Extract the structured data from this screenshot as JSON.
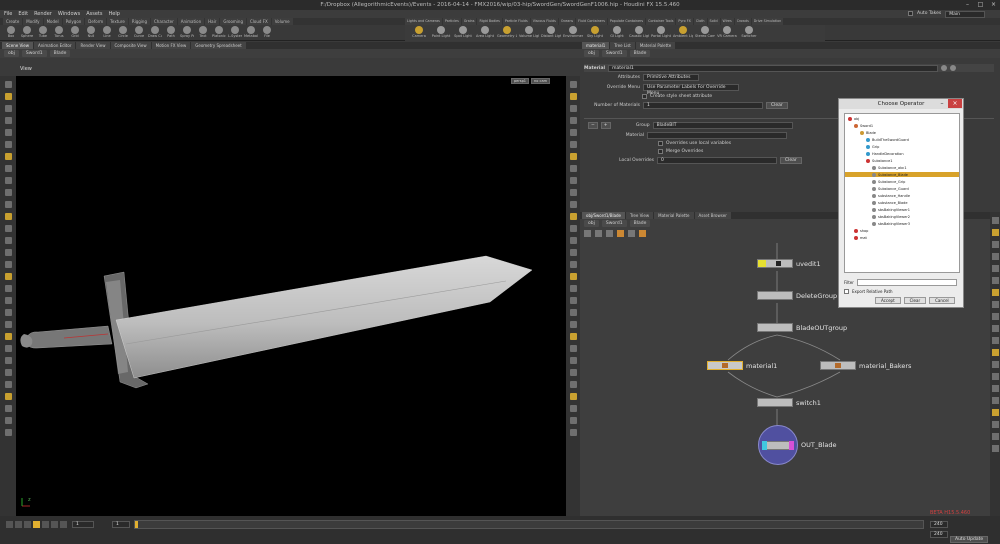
{
  "window": {
    "title": "F:/Dropbox (AllegorithmicEvents)/Events - 2016-04-14 - FMX2016/wip/03-hip/SwordGen/SwordGenF1006.hip - Houdini FX 15.5.460"
  },
  "menu": [
    "File",
    "Edit",
    "Render",
    "Windows",
    "Assets",
    "Help"
  ],
  "shelf_tabs": [
    "Create",
    "Modify",
    "Model",
    "Polygon",
    "Deform",
    "Texture",
    "Rigging",
    "Character",
    "Animation",
    "Hair",
    "Grooming",
    "Cloud FX",
    "Volume"
  ],
  "light_tabs": [
    "Lights and Cameras",
    "Particles",
    "Grains",
    "Rigid Bodies",
    "Particle Fluids",
    "Viscous Fluids",
    "Oceans",
    "Fluid Containers",
    "Populate Containers",
    "Container Tools",
    "Pyro FX",
    "Cloth",
    "Solid",
    "Wires",
    "Crowds",
    "Drive Simulation"
  ],
  "shelf_tools": [
    "Box",
    "Sphere",
    "Tube",
    "Torus",
    "Grid",
    "Null",
    "Line",
    "Circle",
    "Curve",
    "Draw Curve",
    "Path",
    "Spray Paint",
    "Text",
    "Platonic Solids",
    "L-System",
    "Metaball",
    "File"
  ],
  "light_tools": [
    "Camera",
    "Point Light",
    "Spot Light",
    "Area Light",
    "Geometry Light",
    "Volume Light",
    "Distant Light",
    "Environment Light",
    "Sky Light",
    "GI Light",
    "Caustic Light",
    "Portal Light",
    "Ambient Light",
    "Stereo Camera",
    "VR Camera",
    "Switcher"
  ],
  "auto_takes": "Auto Takes",
  "take_menu": "Main",
  "left_pane": {
    "tabs": [
      "Scene View",
      "Animation Editor",
      "Render View",
      "Composite View",
      "Motion FX View",
      "Geometry Spreadsheet"
    ],
    "path": [
      "obj",
      "Sword1",
      "Blade"
    ],
    "view_label": "View",
    "persp": "persp1",
    "cam": "no cam"
  },
  "params": {
    "tabs": [
      "material1",
      "Tree List",
      "Material Palette"
    ],
    "path": [
      "obj",
      "Sword1",
      "Blade"
    ],
    "node_type": "Material",
    "node_name": "material1",
    "attributes_label": "Attributes",
    "attributes_value": "Primitive Attributes",
    "override_label": "Override Menu",
    "override_value": "Use Parameter Labels For Override Menu",
    "style_check": "Create style sheet attribute",
    "num_materials_label": "Number of Materials",
    "num_materials_value": "1",
    "clear_label": "Clear",
    "group_label": "Group",
    "group_value": "BladeBIT",
    "material_label": "Material",
    "local_vars_check": "Overrides use local variables",
    "merge_check": "Merge Overrides",
    "local_overrides_label": "Local Overrides",
    "local_overrides_value": "0",
    "clear2_label": "Clear"
  },
  "network": {
    "tabs": [
      "obj/Sword1/Blade",
      "Tree View",
      "Material Palette",
      "Asset Browser"
    ],
    "path": [
      "obj",
      "Sword1",
      "Blade"
    ],
    "nodes": {
      "uvedit": "uvedit1",
      "delete": "DeleteGroup",
      "bladeout": "BladeOUTgroup",
      "material": "material1",
      "material_bakers": "material_Bakers",
      "switch": "switch1",
      "out": "OUT_Blade"
    }
  },
  "dialog": {
    "title": "Choose Operator",
    "tree": [
      "obj",
      "Sword1",
      "Blade",
      "BuildTheSwordGuard",
      "Grip",
      "HandleDecoration",
      "Substance1",
      "Substance_abc1",
      "Substance_Blade",
      "Substance_Grip",
      "Substance_Guard",
      "substance_Handle",
      "substance_Blade",
      "sbsBakingViewer1",
      "sbsBakingViewer2",
      "sbsBakingViewer3",
      "shop",
      "mat"
    ],
    "filter_label": "Filter",
    "export_label": "Export Relative Path",
    "accept": "Accept",
    "clear": "Clear",
    "cancel": "Cancel"
  },
  "timeline": {
    "start": "1",
    "current": "1",
    "end": "240",
    "end2": "240"
  },
  "watermark": "BETA H15.5.460",
  "auto_update": "Auto Update",
  "colors": {
    "selected_node": "#e2b030",
    "dialog_highlight": "#d8a22a",
    "out_node": "#5050a0"
  }
}
